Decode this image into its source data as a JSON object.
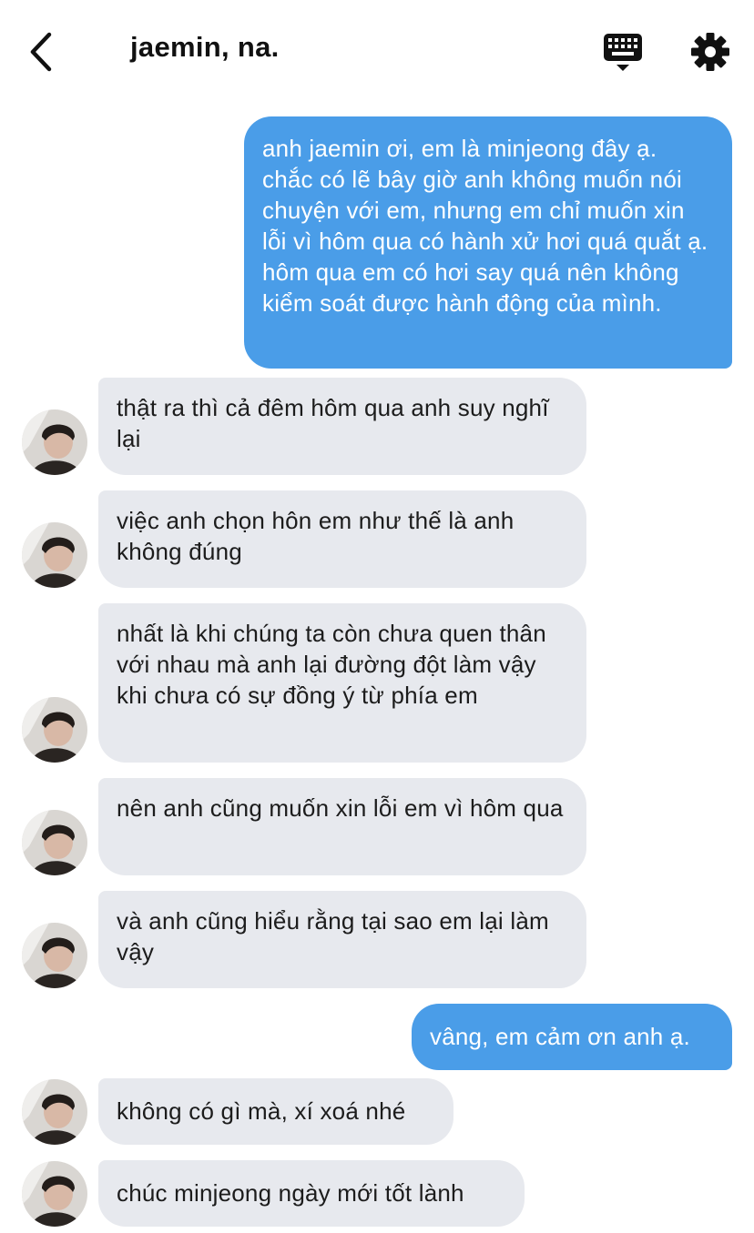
{
  "header": {
    "back_icon": "chevron-left-icon",
    "title": "jaemin, na.",
    "keyboard_icon": "keyboard-icon",
    "settings_icon": "gear-icon"
  },
  "messages": [
    {
      "sender": "me",
      "text": "anh jaemin ơi, em là minjeong đây ạ. chắc có lẽ bây giờ anh không muốn nói chuyện với em, nhưng em chỉ muốn xin lỗi vì hôm qua có hành xử hơi quá quắt ạ. hôm qua em có hơi say quá nên không kiểm soát được hành động của mình."
    },
    {
      "sender": "them",
      "text": "thật ra thì cả đêm hôm qua anh suy nghĩ lại"
    },
    {
      "sender": "them",
      "text": "việc anh chọn hôn em như thế là anh không đúng"
    },
    {
      "sender": "them",
      "text": "nhất là khi chúng ta còn chưa quen thân với nhau mà anh lại đường đột làm vậy khi chưa có sự đồng ý từ phía em"
    },
    {
      "sender": "them",
      "text": "nên anh cũng muốn xin lỗi em vì hôm qua"
    },
    {
      "sender": "them",
      "text": "và anh cũng hiểu rằng tại sao em lại làm vậy"
    },
    {
      "sender": "me",
      "text": "vâng, em cảm ơn anh ạ."
    },
    {
      "sender": "them",
      "text": "không có gì mà, xí xoá nhé"
    },
    {
      "sender": "them",
      "text": "chúc minjeong ngày mới tốt lành"
    }
  ],
  "colors": {
    "outgoing_bubble": "#4a9de8",
    "incoming_bubble": "#e7e9ee",
    "background": "#ffffff"
  }
}
